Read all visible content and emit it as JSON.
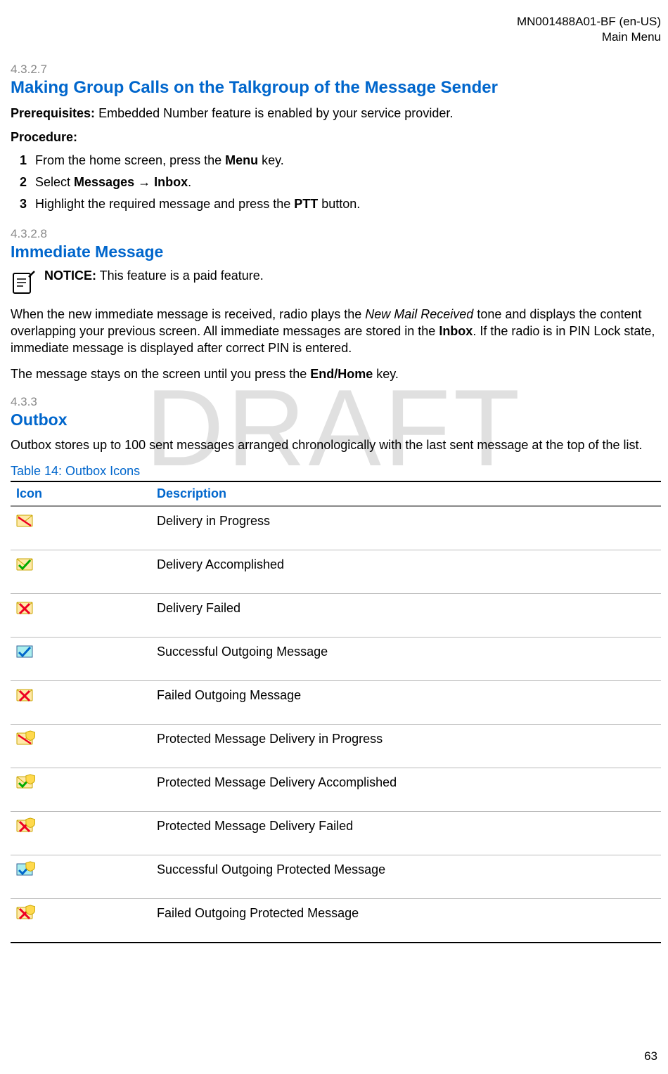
{
  "header": {
    "docId": "MN001488A01-BF (en-US)",
    "section": "Main Menu"
  },
  "sec4327": {
    "num": "4.3.2.7",
    "title": "Making Group Calls on the Talkgroup of the Message Sender",
    "prereqLabel": "Prerequisites:",
    "prereqText": " Embedded Number feature is enabled by your service provider.",
    "procLabel": "Procedure:",
    "steps": [
      {
        "n": "1",
        "pre": "From the home screen, press the ",
        "bold": "Menu",
        "post": " key."
      },
      {
        "n": "2",
        "pre": "Select ",
        "bold": "Messages → Inbox",
        "post": "."
      },
      {
        "n": "3",
        "pre": "Highlight the required message and press the ",
        "bold": "PTT",
        "post": " button."
      }
    ]
  },
  "sec4328": {
    "num": "4.3.2.8",
    "title": "Immediate Message",
    "noticeLabel": "NOTICE:",
    "noticeText": " This feature is a paid feature.",
    "para1a": "When the new immediate message is received, radio plays the ",
    "para1ital": "New Mail Received",
    "para1b": " tone and displays the content overlapping your previous screen. All immediate messages are stored in the ",
    "para1bold": "Inbox",
    "para1c": ". If the radio is in PIN Lock state, immediate message is displayed after correct PIN is entered.",
    "para2a": "The message stays on the screen until you press the ",
    "para2bold": "End/Home",
    "para2b": " key."
  },
  "sec433": {
    "num": "4.3.3",
    "title": "Outbox",
    "para": "Outbox stores up to 100 sent messages arranged chronologically with the last sent message at the top of the list."
  },
  "table": {
    "caption": "Table 14: Outbox Icons",
    "colIcon": "Icon",
    "colDesc": "Description",
    "rows": [
      {
        "icon": "delivery-progress-icon",
        "desc": "Delivery in Progress"
      },
      {
        "icon": "delivery-accomplished-icon",
        "desc": "Delivery Accomplished"
      },
      {
        "icon": "delivery-failed-icon",
        "desc": "Delivery Failed"
      },
      {
        "icon": "success-outgoing-icon",
        "desc": "Successful Outgoing Message"
      },
      {
        "icon": "failed-outgoing-icon",
        "desc": "Failed Outgoing Message"
      },
      {
        "icon": "protected-progress-icon",
        "desc": "Protected Message Delivery in Progress"
      },
      {
        "icon": "protected-accomplished-icon",
        "desc": "Protected Message Delivery Accomplished"
      },
      {
        "icon": "protected-failed-icon",
        "desc": "Protected Message Delivery Failed"
      },
      {
        "icon": "success-outgoing-protected-icon",
        "desc": "Successful Outgoing Protected Message"
      },
      {
        "icon": "failed-outgoing-protected-icon",
        "desc": "Failed Outgoing Protected Message"
      }
    ]
  },
  "watermark": "DRAFT",
  "pageNum": "63"
}
